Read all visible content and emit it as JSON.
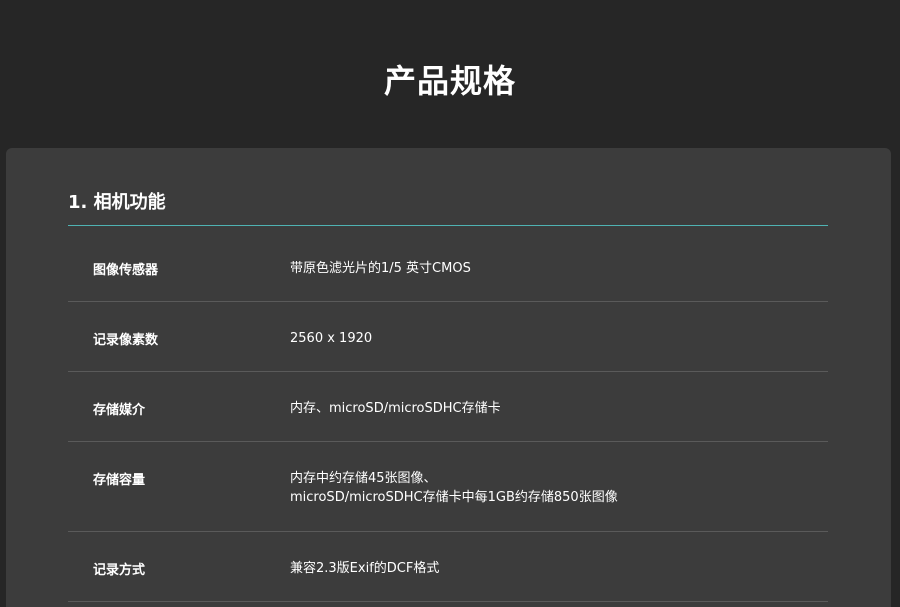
{
  "page": {
    "title": "产品规格"
  },
  "section": {
    "title": "1. 相机功能"
  },
  "specs": [
    {
      "label": "图像传感器",
      "lines": [
        "带原色滤光片的1/5 英寸CMOS"
      ]
    },
    {
      "label": "记录像素数",
      "lines": [
        "2560 x 1920"
      ]
    },
    {
      "label": "存储媒介",
      "lines": [
        "内存、microSD/microSDHC存储卡"
      ]
    },
    {
      "label": "存储容量",
      "lines": [
        "内存中约存储45张图像、",
        "microSD/microSDHC存储卡中每1GB约存储850张图像"
      ]
    },
    {
      "label": "记录方式",
      "lines": [
        "兼容2.3版Exif的DCF格式"
      ]
    }
  ],
  "colors": {
    "background": "#262626",
    "card": "#3c3c3c",
    "accent_rule": "#4fb3b3",
    "row_divider": "#5a5a5a"
  }
}
